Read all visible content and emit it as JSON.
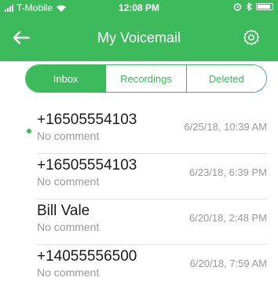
{
  "status_bar": {
    "carrier": "T-Mobile",
    "time": "12:08 PM"
  },
  "nav": {
    "title": "My Voicemail"
  },
  "tabs": [
    {
      "label": "Inbox",
      "active": true
    },
    {
      "label": "Recordings",
      "active": false
    },
    {
      "label": "Deleted",
      "active": false
    }
  ],
  "voicemails": [
    {
      "caller": "+16505554103",
      "comment": "No comment",
      "time": "6/25/18, 10:39 AM",
      "unread": true
    },
    {
      "caller": "+16505554103",
      "comment": "No comment",
      "time": "6/23/18, 6:39 PM",
      "unread": false
    },
    {
      "caller": "Bill Vale",
      "comment": "No comment",
      "time": "6/20/18, 2:48 PM",
      "unread": false
    },
    {
      "caller": "+14055556500",
      "comment": "No comment",
      "time": "6/20/18, 7:59 AM",
      "unread": false
    }
  ],
  "colors": {
    "accent": "#3dbb5c",
    "muted_text": "#9a9a9a"
  },
  "icons": {
    "back": "back-arrow-icon",
    "settings": "gear-icon",
    "wifi": "wifi-icon",
    "alarm": "alarm-icon",
    "bluetooth": "bluetooth-icon",
    "battery": "battery-icon"
  }
}
